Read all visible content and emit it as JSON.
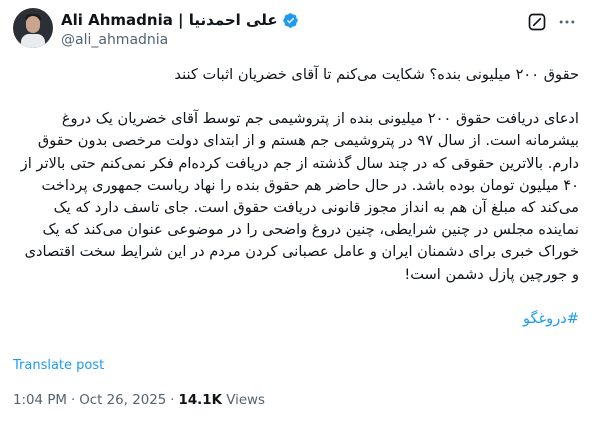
{
  "author": {
    "display_name": "Ali Ahmadnia | علی احمدنیا",
    "handle": "@ali_ahmadnia",
    "verified": true
  },
  "icons": {
    "verified": "verified-badge-icon",
    "grok": "grok-icon",
    "more": "more-options-icon"
  },
  "tweet": {
    "headline": "حقوق ۲۰۰ میلیونی بنده؟ شکایت می‌کنم تا آقای خضریان اثبات کنند",
    "paragraph": "ادعای دریافت حقوق ۲۰۰ میلیونی بنده از پتروشیمی جم توسط آقای خضریان یک دروغ بیشرمانه است. از سال ۹۷ در پتروشیمی جم هستم و از ابتدای دولت مرخصی بدون حقوق دارم. بالاترین حقوقی که در چند سال گذشته از جم دریافت کرده‌ام فکر نمی‌کنم حتی بالاتر از ۴۰ میلیون تومان بوده باشد. در حال حاضر هم حقوق بنده را نهاد ریاست جمهوری پرداخت می‌کند که مبلغ آن هم به انداز مجوز قانونی دریافت حقوق است. جای تاسف دارد که یک نماینده مجلس در چنین شرایطی، چنین دروغ واضحی را در موضوعی عنوان می‌کند که یک خوراک خبری برای دشمنان ایران و عامل عصبانی کردن مردم در این شرایط سخت اقتصادی و جورچین پازل دشمن است!",
    "hashtag": "#دروغگو"
  },
  "translate_label": "Translate post",
  "meta": {
    "time": "1:04 PM",
    "separator": "·",
    "date": "Oct 26, 2025",
    "views_count": "14.1K",
    "views_label": "Views"
  },
  "colors": {
    "link": "#1d9bf0",
    "secondary_text": "#536471",
    "primary_text": "#0f1419"
  }
}
